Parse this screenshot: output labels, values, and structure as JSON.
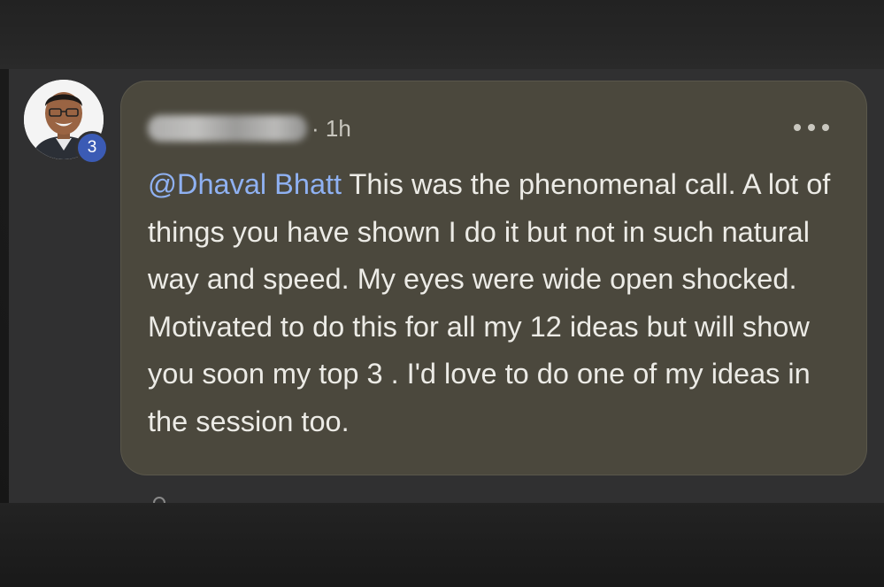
{
  "comment": {
    "reply_count_badge": "3",
    "timestamp": "1h",
    "timestamp_separator": "·",
    "author_name_redacted": true,
    "mention": "@Dhaval Bhatt",
    "body": " This was the phenomenal call. A lot of things you have shown I do it but not in such natural way and speed. My eyes were wide open shocked. Motivated to do this for all my 12 ideas but will show you soon my top 3 . I'd love to do one of my ideas in the session too.",
    "more_options_icon": "ellipsis-icon",
    "avatar_icon": "user-avatar"
  },
  "colors": {
    "bubble_background": "#4b483d",
    "screen_background": "#303031",
    "mention_link": "#8fb1f2",
    "badge": "#3b5bb5",
    "text": "#ecebe6",
    "meta_text": "#c9c7bf"
  }
}
